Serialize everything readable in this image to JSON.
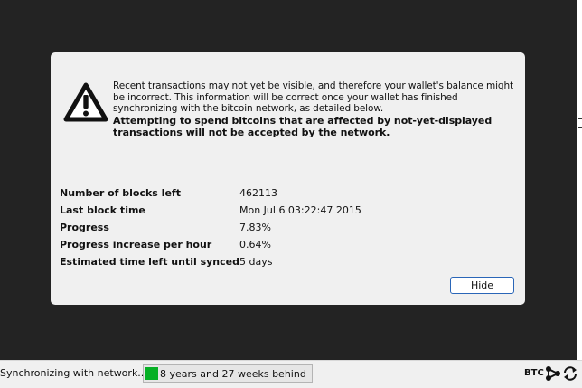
{
  "overlay": {
    "message": "Recent transactions may not yet be visible, and therefore your wallet's balance might be incorrect. This information will be correct once your wallet has finished synchronizing with the bitcoin network, as detailed below.",
    "warning": "Attempting to spend bitcoins that are affected by not-yet-displayed transactions will not be accepted by the network.",
    "rows": [
      {
        "label": "Number of blocks left",
        "value": "462113"
      },
      {
        "label": "Last block time",
        "value": "Mon Jul 6 03:22:47 2015"
      },
      {
        "label": "Progress",
        "value": "7.83%"
      },
      {
        "label": "Progress increase per hour",
        "value": "0.64%"
      },
      {
        "label": "Estimated time left until synced",
        "value": "5 days"
      }
    ],
    "hide_label": "Hide",
    "icon": "warning-icon"
  },
  "statusbar": {
    "sync_label": "Synchronizing with network...",
    "progress_text": "8 years and 27 weeks behind",
    "progress_fraction": 0.0783,
    "unit": "BTC",
    "icons": [
      "network-icon",
      "sync-icon"
    ],
    "progress_color": "#06b025"
  },
  "colors": {
    "background": "#232323",
    "dialog": "#f0f0f0",
    "button_border": "#2a66b8"
  }
}
